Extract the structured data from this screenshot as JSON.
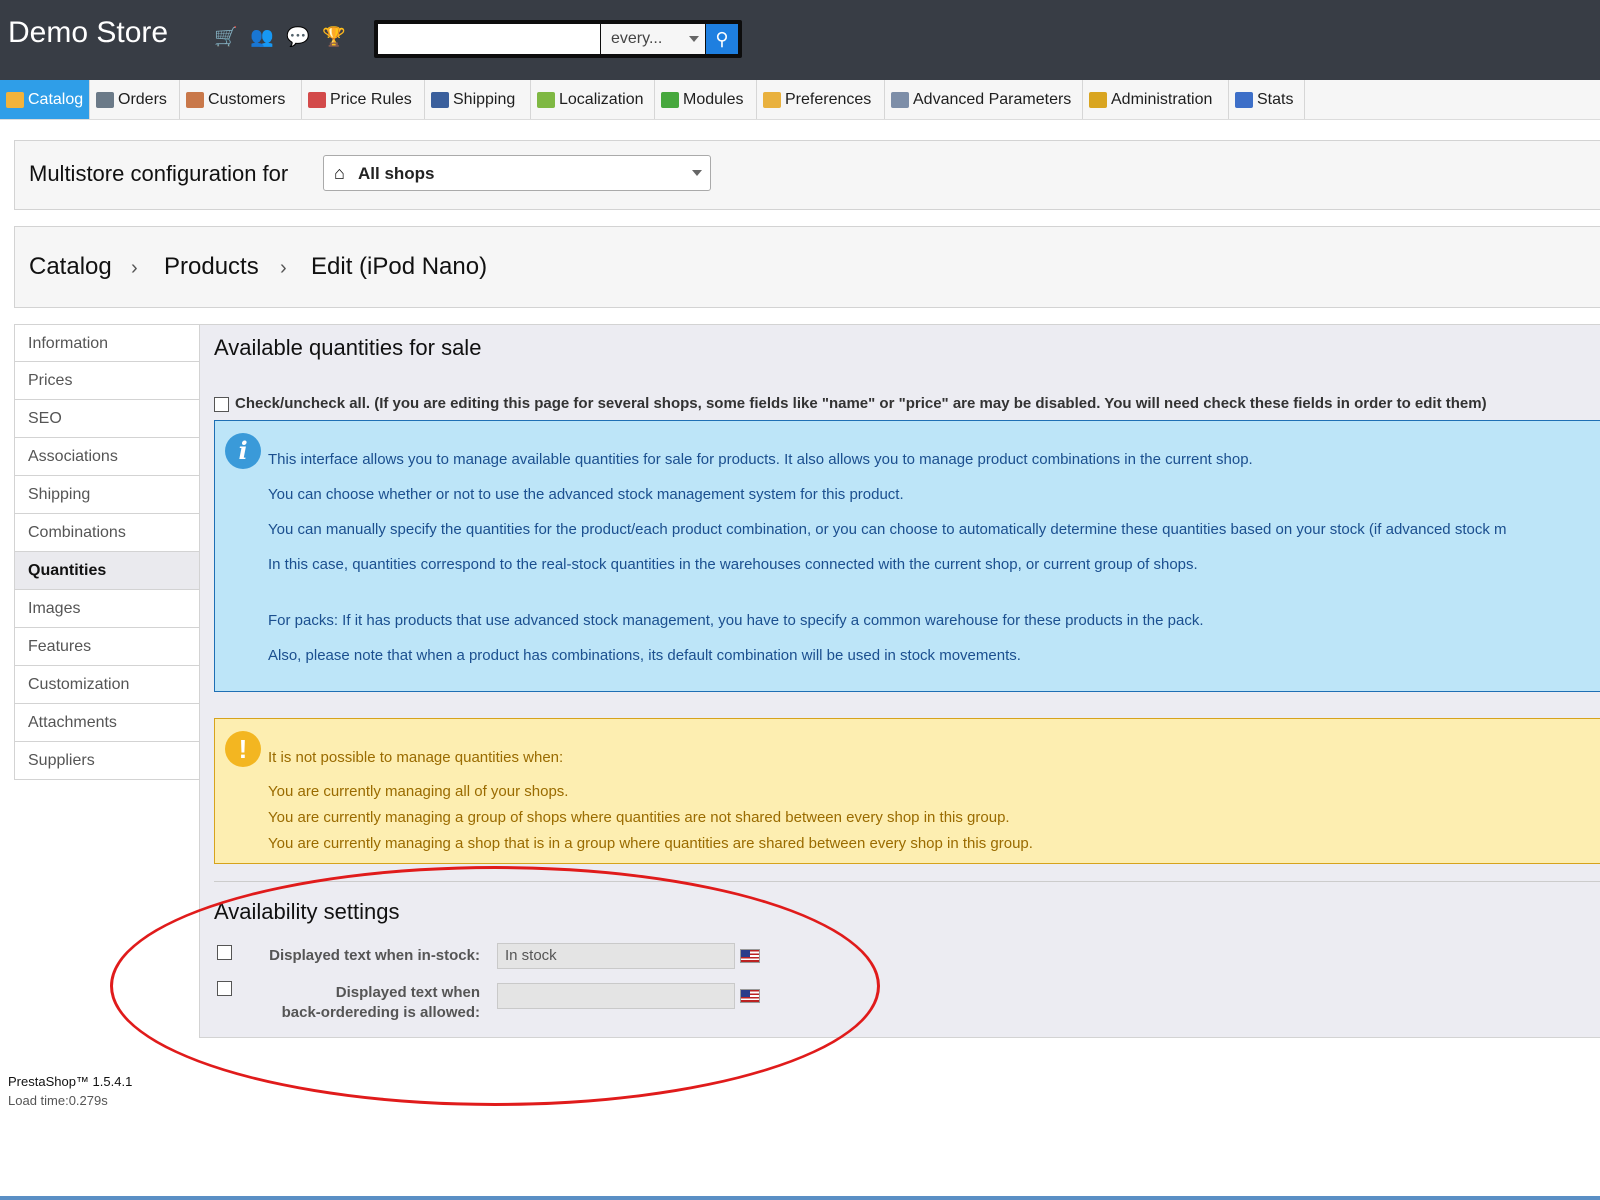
{
  "header": {
    "brand": "Demo Store",
    "quick_icons": [
      "cart-icon",
      "customers-icon",
      "messages-icon",
      "trophy-icon"
    ],
    "search": {
      "value": "",
      "placeholder": "",
      "scope": "every..."
    }
  },
  "tabs": [
    {
      "label": "Catalog",
      "active": true,
      "icon": "catalog-icon",
      "color": "#f2b33b"
    },
    {
      "label": "Orders",
      "icon": "orders-icon",
      "color": "#6b7a88"
    },
    {
      "label": "Customers",
      "icon": "customers-icon",
      "color": "#c9784a"
    },
    {
      "label": "Price Rules",
      "icon": "price-rules-icon",
      "color": "#d34a4a"
    },
    {
      "label": "Shipping",
      "icon": "shipping-icon",
      "color": "#3a5f9c"
    },
    {
      "label": "Localization",
      "icon": "localization-icon",
      "color": "#7fb843"
    },
    {
      "label": "Modules",
      "icon": "modules-icon",
      "color": "#47a83d"
    },
    {
      "label": "Preferences",
      "icon": "preferences-icon",
      "color": "#e9b13e"
    },
    {
      "label": "Advanced Parameters",
      "icon": "wrench-icon",
      "color": "#7d8ea8"
    },
    {
      "label": "Administration",
      "icon": "key-icon",
      "color": "#d9a520"
    },
    {
      "label": "Stats",
      "icon": "stats-icon",
      "color": "#3d6fc8"
    }
  ],
  "multistore": {
    "label": "Multistore configuration for",
    "selected": "All shops"
  },
  "breadcrumb": {
    "items": [
      "Catalog",
      "Products",
      "Edit (iPod Nano)"
    ]
  },
  "left_menu": {
    "items": [
      "Information",
      "Prices",
      "SEO",
      "Associations",
      "Shipping",
      "Combinations",
      "Quantities",
      "Images",
      "Features",
      "Customization",
      "Attachments",
      "Suppliers"
    ],
    "active": "Quantities"
  },
  "main": {
    "title": "Available quantities for sale",
    "check_all_label": "Check/uncheck all. (If you are editing this page for several shops, some fields like \"name\" or \"price\" are may be disabled. You will need check these fields in order to edit them)",
    "info_lines": [
      "This interface allows you to manage available quantities for sale for products. It also allows you to manage product combinations in the current shop.",
      "You can choose whether or not to use the advanced stock management system for this product.",
      "You can manually specify the quantities for the product/each product combination, or you can choose to automatically determine these quantities based on your stock (if advanced stock m",
      "In this case, quantities correspond to the real-stock quantities in the warehouses connected with the current shop, or current group of shops.",
      "For packs: If it has products that use advanced stock management, you have to specify a common warehouse for these products in the pack.",
      "Also, please note that when a product has combinations, its default combination will be used in stock movements."
    ],
    "warning_lines": [
      "It is not possible to manage quantities when:",
      "You are currently managing all of your shops.",
      "You are currently managing a group of shops where quantities are not shared between every shop in this group.",
      "You are currently managing a shop that is in a group where quantities are shared between every shop in this group."
    ],
    "availability": {
      "title": "Availability settings",
      "in_stock_label": "Displayed text when in-stock:",
      "in_stock_value": "In stock",
      "backorder_label_line1": "Displayed text when",
      "backorder_label_line2": "back-ordereding is allowed:",
      "backorder_value": ""
    }
  },
  "footer": {
    "version": "PrestaShop™ 1.5.4.1",
    "load_time": "Load time:0.279s"
  },
  "colors": {
    "header_bg": "#383d45",
    "active_tab": "#2f9ee8",
    "info_bg": "#bde5f8",
    "warning_bg": "#fdeeb1",
    "annotation": "#e01b1b"
  }
}
